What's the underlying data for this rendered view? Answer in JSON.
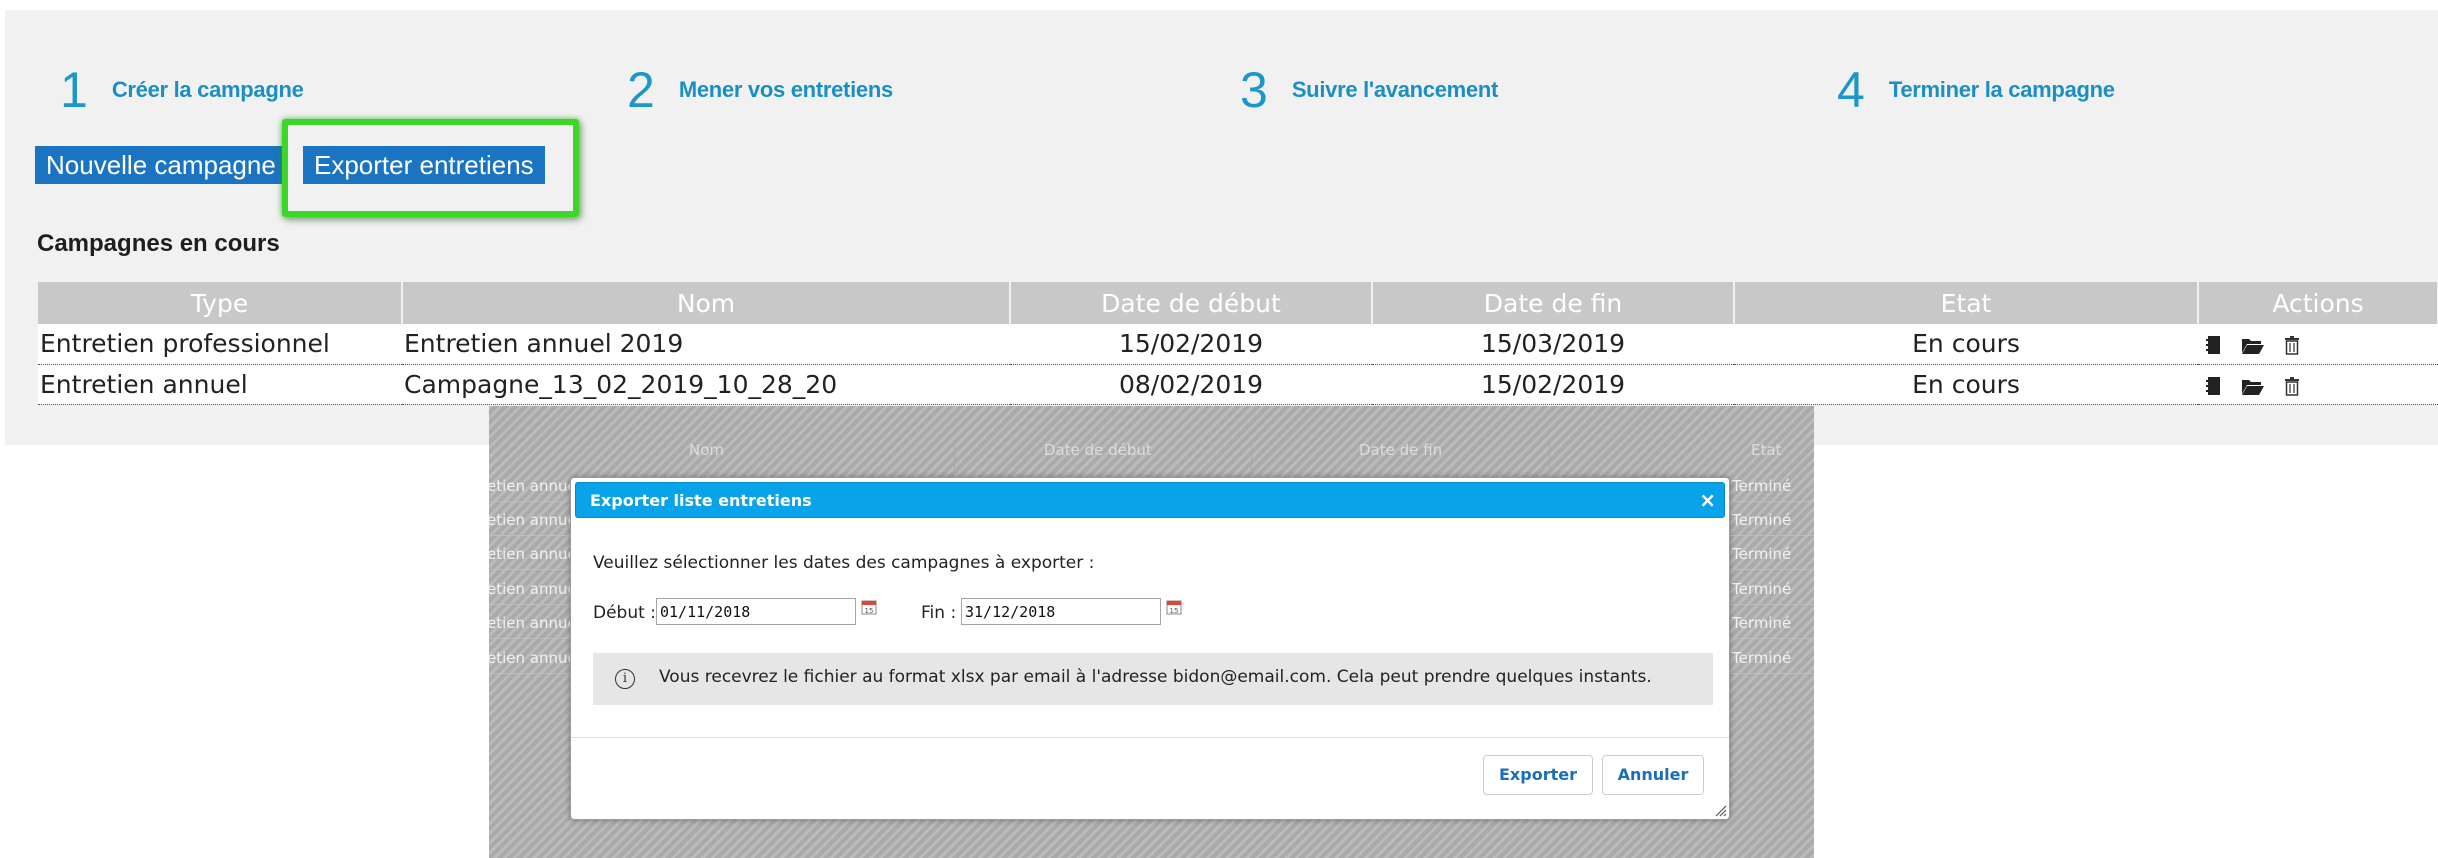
{
  "steps": [
    {
      "number": "1",
      "label": "Créer la campagne"
    },
    {
      "number": "2",
      "label": "Mener vos entretiens"
    },
    {
      "number": "3",
      "label": "Suivre l'avancement"
    },
    {
      "number": "4",
      "label": "Terminer la campagne"
    }
  ],
  "toolbar": {
    "new_campaign_label": "Nouvelle campagne",
    "export_label": "Exporter entretiens"
  },
  "section_title": "Campagnes en cours",
  "table": {
    "headers": [
      "Type",
      "Nom",
      "Date de début",
      "Date de fin",
      "Etat",
      "Actions"
    ],
    "rows": [
      {
        "type": "Entretien professionnel",
        "name": "Entretien annuel 2019",
        "start": "15/02/2019",
        "end": "15/03/2019",
        "status": "En cours",
        "actions": [
          "notebook-icon",
          "folder-open-icon",
          "trash-icon"
        ]
      },
      {
        "type": "Entretien annuel",
        "name": "Campagne_13_02_2019_10_28_20",
        "start": "08/02/2019",
        "end": "15/02/2019",
        "status": "En cours",
        "actions": [
          "notebook-icon",
          "folder-open-icon",
          "trash-icon"
        ]
      }
    ]
  },
  "background_table": {
    "headers": [
      "Nom",
      "Date de début",
      "Date de fin",
      "Etat"
    ],
    "row_left": "etien annuel",
    "row_right": "Terminé"
  },
  "dialog": {
    "title": "Exporter liste entretiens",
    "close_glyph": "×",
    "instructions": "Veuillez sélectionner les dates des campagnes à exporter :",
    "start_label": "Début :",
    "start_value": "01/11/2018",
    "end_label": "Fin :",
    "end_value": "31/12/2018",
    "info_glyph": "i",
    "info_text": "Vous recevrez le fichier au format xlsx par email à l'adresse bidon@email.com. Cela peut prendre quelques instants.",
    "export_label": "Exporter",
    "cancel_label": "Annuler"
  },
  "colors": {
    "accent": "#1a74c1",
    "step_color": "#1b97c8",
    "highlight": "#3ed62a",
    "dialog_title_bg": "#08a3e9"
  }
}
